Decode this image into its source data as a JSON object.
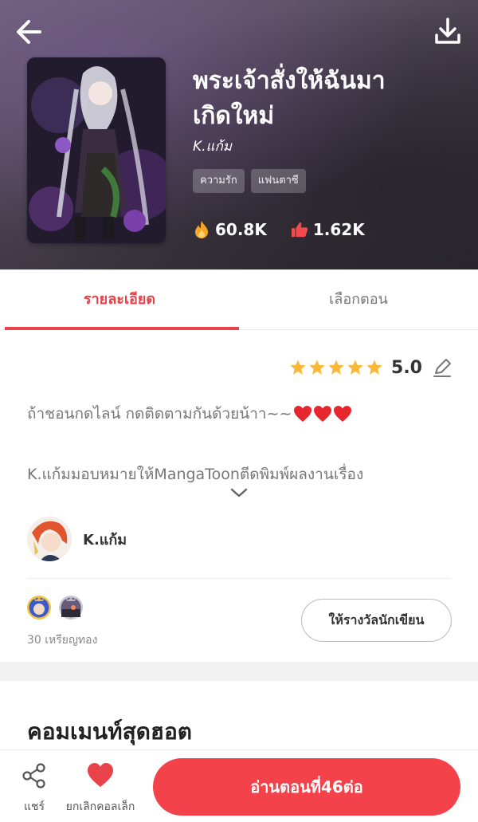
{
  "header": {
    "title_line1": "พระเจ้าสั่งให้ฉันมา",
    "title_line2": "เกิดใหม่",
    "author": "K.แก้ม",
    "tags": [
      "ความรัก",
      "แฟนตาซี"
    ],
    "views": "60.8K",
    "likes": "1.62K",
    "back_icon": "arrow-left",
    "download_icon": "download"
  },
  "tabs": [
    {
      "label": "รายละเอียด",
      "active": true
    },
    {
      "label": "เลือกตอน",
      "active": false
    }
  ],
  "detail": {
    "rating": "5.0",
    "stars": 5,
    "description_line1": "ถ้าชอนกดไลน์  กดติดตามกันด้วยน้าา~~",
    "description_line2": "K.แก้มมอบหมายให้MangaToonตีดพิมพ์ผลงานเรื่อง",
    "author_name": "K.แก้ม",
    "supporters_count": "30 เหรียญทอง",
    "reward_button": "ให้รางวัลนักเขียน"
  },
  "comments": {
    "hot_title": "คอมเมนท์สุดฮอต"
  },
  "bottom_bar": {
    "share_label": "แชร์",
    "unfollow_label": "ยกเลิกคอลเล็ก",
    "read_button": "อ่านตอนที่46ต่อ"
  },
  "colors": {
    "accent": "#f4424a",
    "tab_active": "#e8434a",
    "star": "#f8b93a"
  }
}
